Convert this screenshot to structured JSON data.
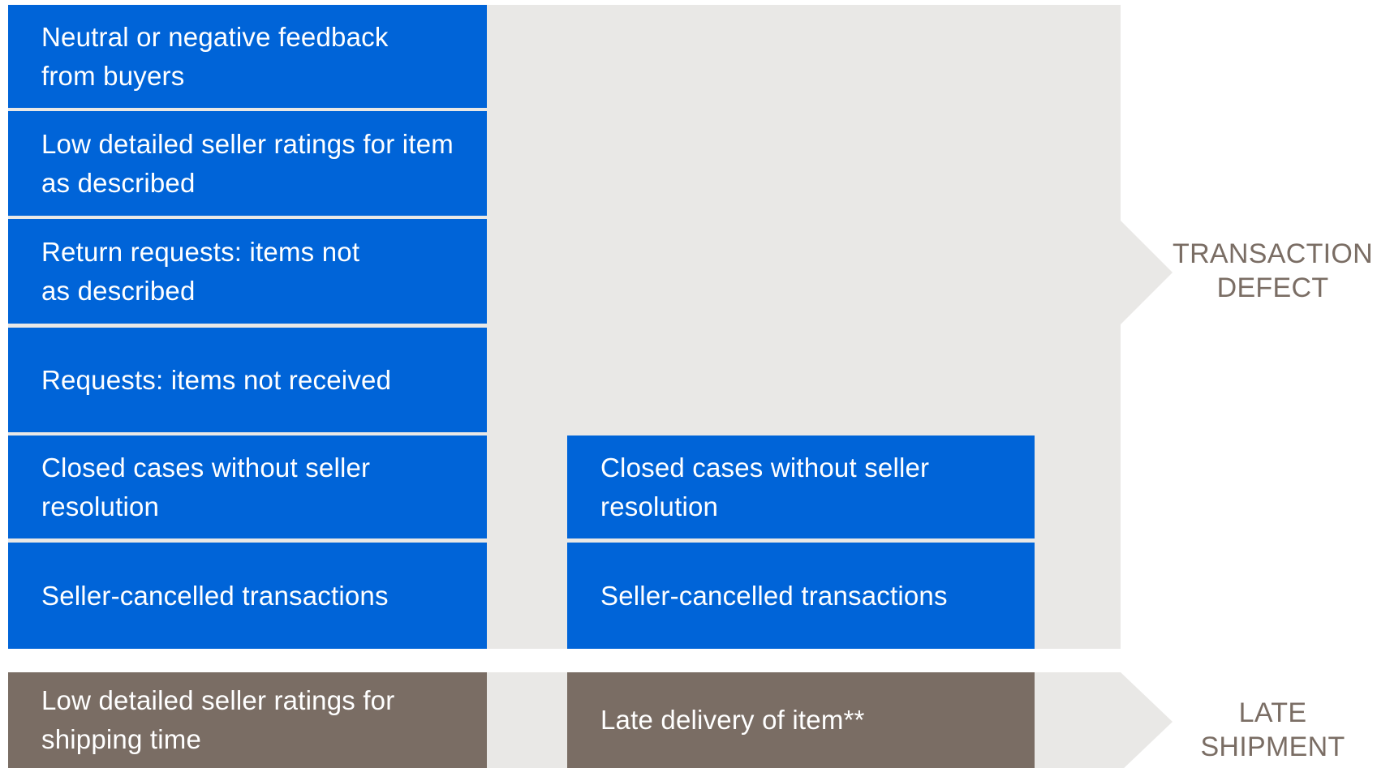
{
  "colors": {
    "defect_box": "#0064d8",
    "shipment_box": "#7a6d64",
    "band": "#e9e8e6",
    "label_text": "#7a6d64"
  },
  "left_column": {
    "items": [
      "Neutral or negative feedback\nfrom buyers",
      "Low detailed seller ratings for item\nas described",
      "Return requests: items not\nas described",
      "Requests: items not received",
      "Closed cases without seller\nresolution",
      "Seller-cancelled transactions"
    ],
    "shipment_item": "Low detailed seller ratings for\nshipping time"
  },
  "right_column": {
    "items": [
      "Closed cases without seller\nresolution",
      "Seller-cancelled transactions"
    ],
    "shipment_item": "Late delivery of item**"
  },
  "labels": {
    "transaction_defect": "TRANSACTION\nDEFECT",
    "late_shipment": "LATE\nSHIPMENT"
  }
}
